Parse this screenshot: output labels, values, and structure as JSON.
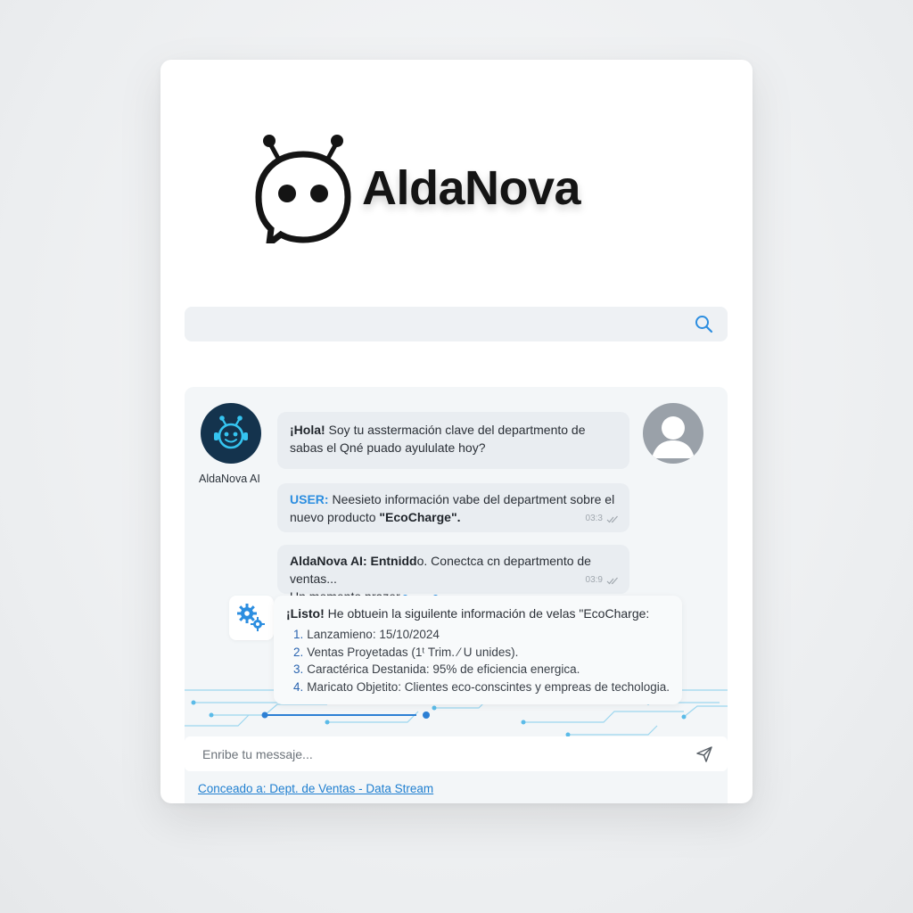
{
  "brand": {
    "name": "AldaNova",
    "logo_icon": "robot-chat-bubble-icon"
  },
  "search": {
    "value": "",
    "placeholder": "",
    "icon": "search-icon"
  },
  "chat": {
    "bot_avatar_icon": "robot-avatar-icon",
    "bot_name": "AldaNova AI",
    "user_avatar_icon": "user-avatar-icon",
    "messages": [
      {
        "lead": "¡Hola!",
        "text_line1": " Soy tu asstermación clave del departmento de",
        "text_line2": "sabas el Qné puado ayululate hoy?"
      },
      {
        "sender": "USER:",
        "text_line1": " Neesieto información vabe del department sobre el",
        "text_line2": "nuevo producto ",
        "product": "\"EcoCharge\".",
        "time": "03:3"
      },
      {
        "sender": "AldaNova AI:",
        "text_line1": " Entnidd",
        "text_line1b": "o. Conectca cn departmento de ventas...",
        "text_line2": "Un momento prazer",
        "time": "03:9"
      },
      {
        "icon": "gears-icon",
        "lead": "¡Listo!",
        "intro": " He obtuein la siguilente información de velas \"EcoCharge:",
        "items": [
          {
            "n": "1.",
            "text": "Lanzamieno: 15/10/2024"
          },
          {
            "n": "2.",
            "text": "Ventas Proyetadas (1ᵗ Trim. ⁄ U unides)."
          },
          {
            "n": "3.",
            "text": "Caractérica Destanida: 95% de eficiencia energica."
          },
          {
            "n": "4.",
            "text": "Maricato Objetito: Clientes eco-conscintes y empreas de techologia."
          }
        ]
      }
    ],
    "composer": {
      "value": "",
      "placeholder": "Enribe tu messaje...",
      "send_icon": "send-icon"
    },
    "connection_link": "Conceado a: Dept. de Ventas - Data Stream"
  },
  "colors": {
    "accent": "#2c8ee0",
    "bot_avatar_bg": "#14334d",
    "bot_avatar_glow": "#35c4f0",
    "bubble_bg": "#e9edf1",
    "panel_bg": "#f3f6f8"
  }
}
